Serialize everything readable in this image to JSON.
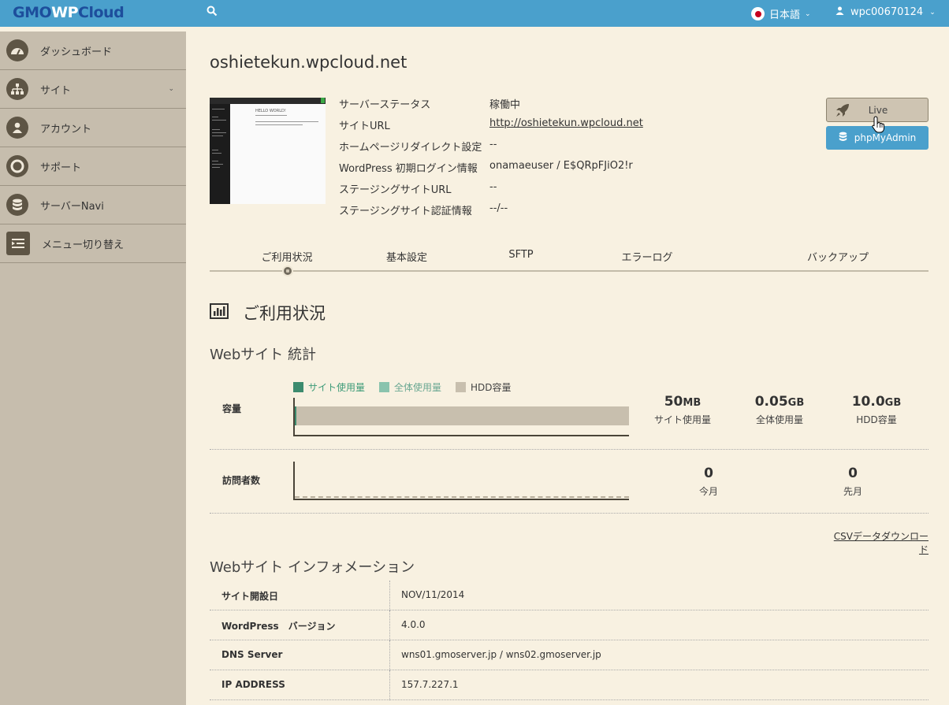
{
  "header": {
    "logo_left": "GMO",
    "logo_w": "WP",
    "logo_right": "Cloud",
    "language": "日本語",
    "username": "wpc00670124"
  },
  "sidebar": {
    "items": [
      {
        "label": "ダッシュボード",
        "icon": "dashboard-icon"
      },
      {
        "label": "サイト",
        "icon": "sitemap-icon",
        "has_submenu": true
      },
      {
        "label": "アカウント",
        "icon": "user-icon"
      },
      {
        "label": "サポート",
        "icon": "lifebuoy-icon"
      },
      {
        "label": "サーバーNavi",
        "icon": "database-icon"
      },
      {
        "label": "メニュー切り替え",
        "icon": "menu-toggle-icon"
      }
    ]
  },
  "site": {
    "domain": "oshietekun.wpcloud.net",
    "preview_heading": "HELLO WORLD!",
    "info": [
      {
        "label": "サーバーステータス",
        "value": "稼働中"
      },
      {
        "label": "サイトURL",
        "value": "http://oshietekun.wpcloud.net"
      },
      {
        "label": "ホームページリダイレクト設定",
        "value": "--"
      },
      {
        "label": "WordPress 初期ログイン情報",
        "value": "onamaeuser / E$QRpFJiO2!r"
      },
      {
        "label": "ステージングサイトURL",
        "value": "--"
      },
      {
        "label": "ステージングサイト認証情報",
        "value": "--/--"
      }
    ],
    "live_label": "Live",
    "phpmyadmin_label": "phpMyAdmin"
  },
  "tabs": [
    "ご利用状況",
    "基本設定",
    "SFTP",
    "エラーログ",
    "バックアップ"
  ],
  "usage": {
    "heading": "ご利用状況",
    "stats_heading": "Webサイト 統計",
    "legend": [
      {
        "label": "サイト使用量",
        "color": "#3d8b6e"
      },
      {
        "label": "全体使用量",
        "color": "#8ac3ad"
      },
      {
        "label": "HDD容量",
        "color": "#c8bfae"
      }
    ],
    "capacity_label": "容量",
    "capacity": {
      "site_value": "50",
      "site_unit": "MB",
      "site_label": "サイト使用量",
      "all_value": "0.05",
      "all_unit": "GB",
      "all_label": "全体使用量",
      "hdd_value": "10.0",
      "hdd_unit": "GB",
      "hdd_label": "HDD容量",
      "site_fraction": 0.005,
      "all_fraction": 0.005
    },
    "visitors_label": "訪問者数",
    "visitors": {
      "this_month_value": "0",
      "this_month_label": "今月",
      "last_month_value": "0",
      "last_month_label": "先月"
    },
    "csv_link": "CSVデータダウンロード"
  },
  "website_info": {
    "heading": "Webサイト インフォメーション",
    "rows": [
      {
        "key": "サイト開設日",
        "value": "NOV/11/2014"
      },
      {
        "key": "WordPress　バージョン",
        "value": "4.0.0"
      },
      {
        "key": "DNS Server",
        "value": "wns01.gmoserver.jp / wns02.gmoserver.jp"
      },
      {
        "key": "IP ADDRESS",
        "value": "157.7.227.1"
      }
    ]
  }
}
